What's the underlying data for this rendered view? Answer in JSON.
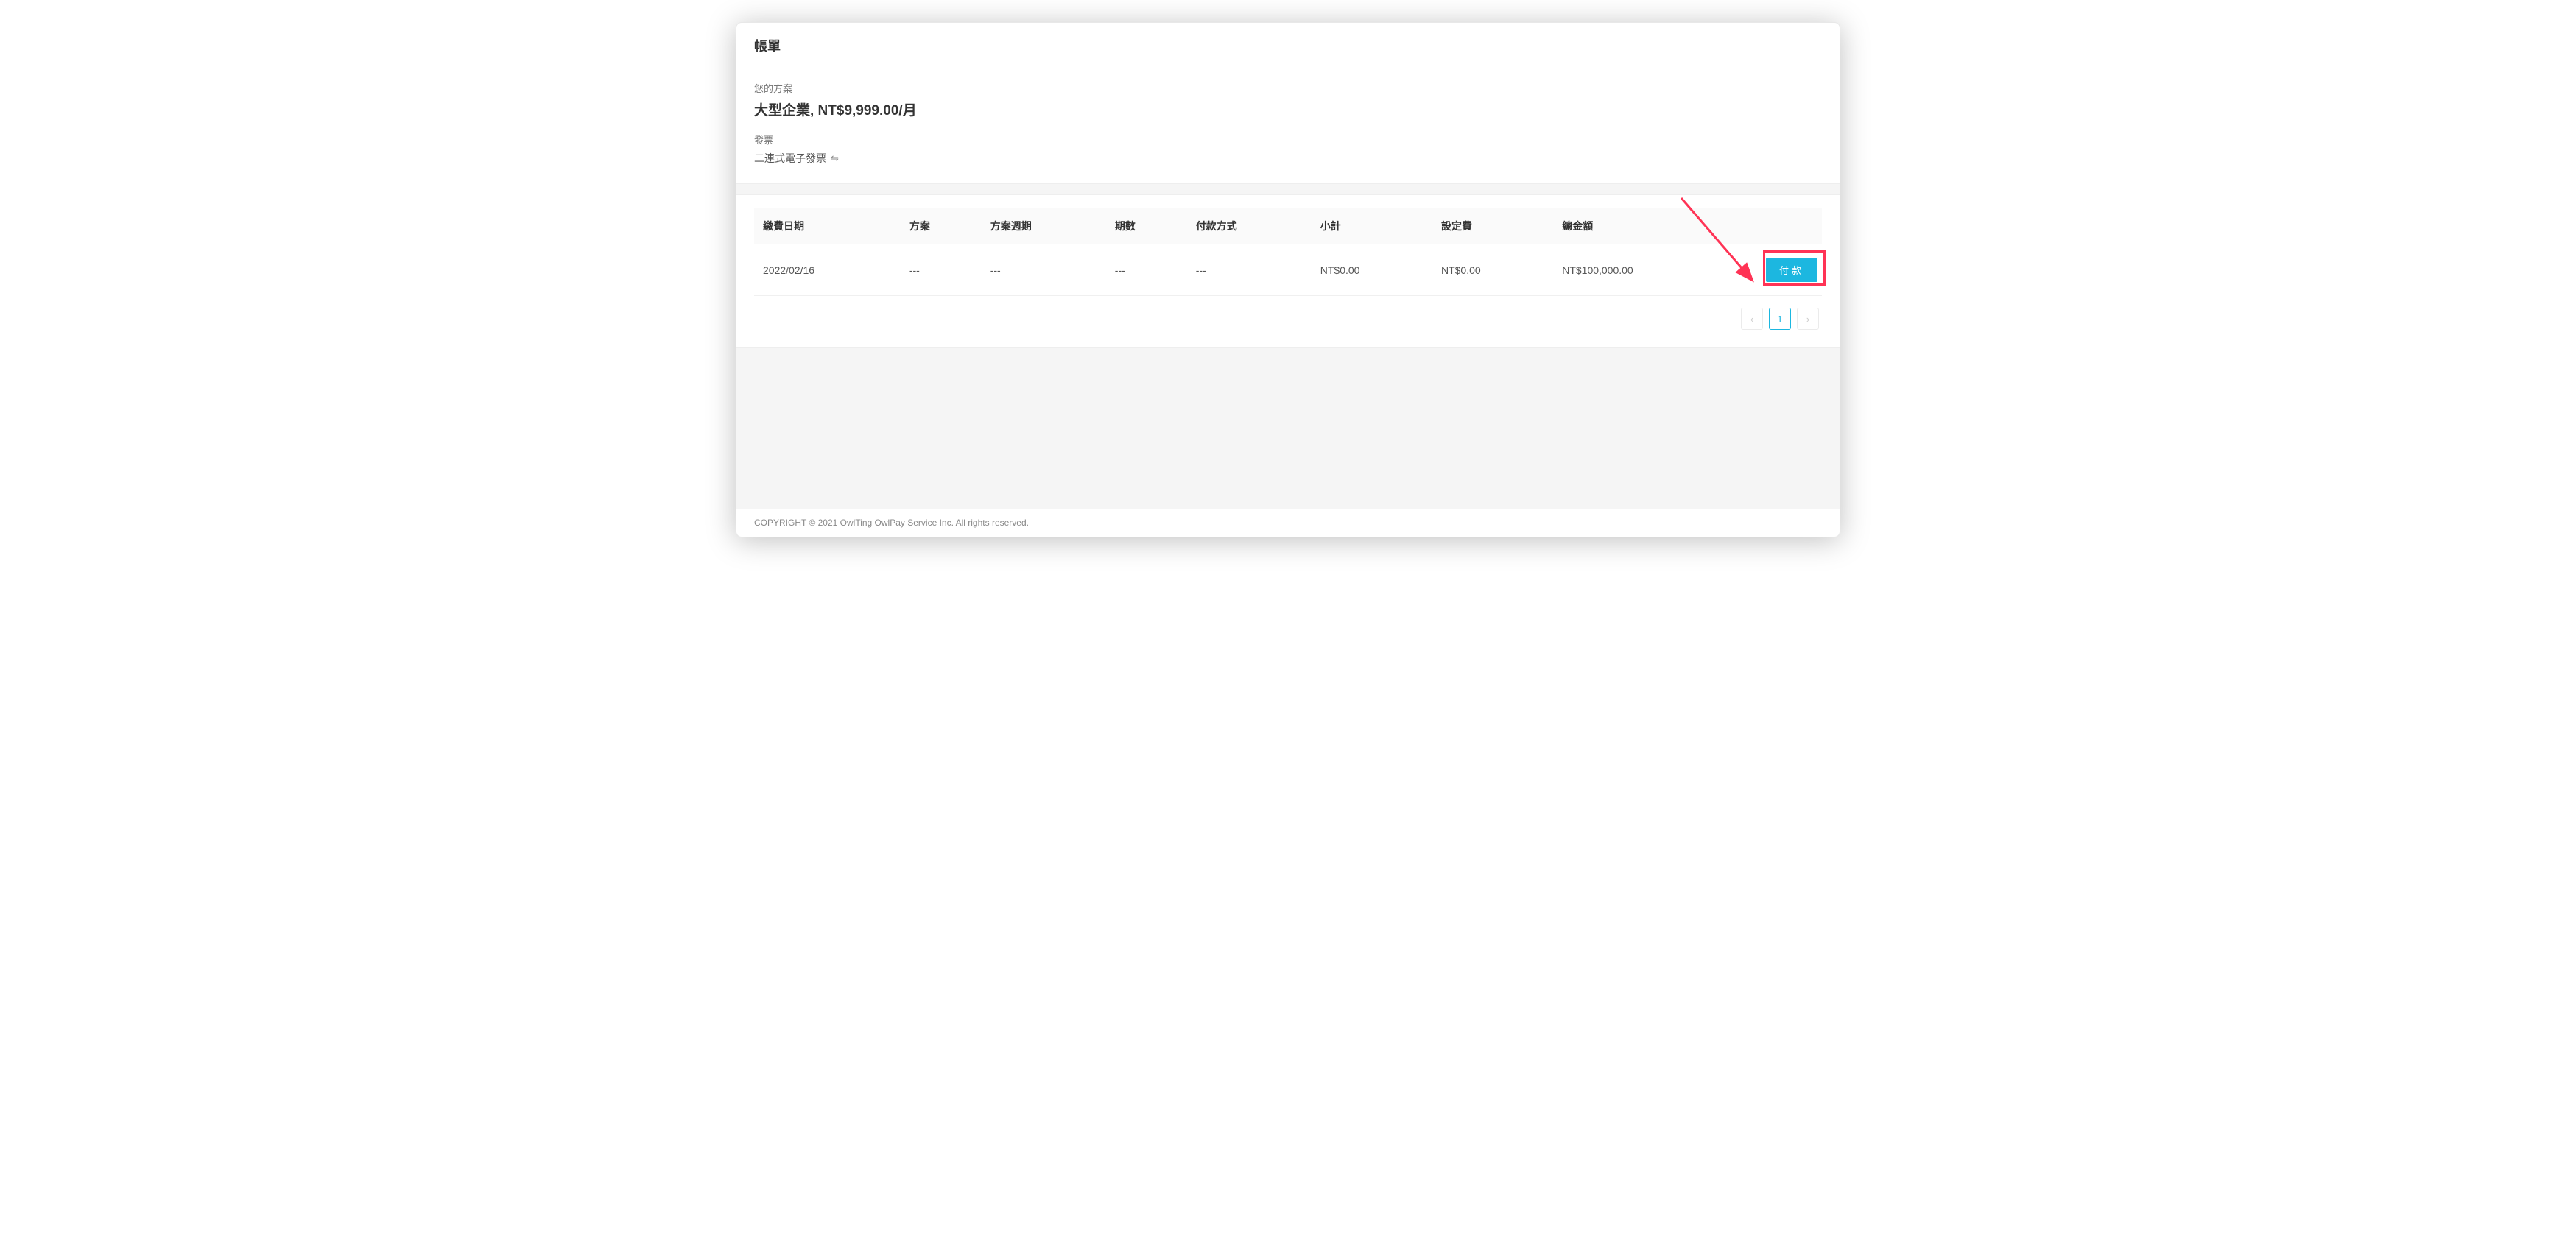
{
  "page": {
    "title": "帳單"
  },
  "plan": {
    "label": "您的方案",
    "value": "大型企業, NT$9,999.00/月"
  },
  "invoice": {
    "label": "發票",
    "value": "二連式電子發票"
  },
  "table": {
    "headers": {
      "date": "繳費日期",
      "plan": "方案",
      "period": "方案週期",
      "term": "期數",
      "payment_method": "付款方式",
      "subtotal": "小計",
      "setup_fee": "設定費",
      "total": "總金額",
      "action": ""
    },
    "row": {
      "date": "2022/02/16",
      "plan": "---",
      "period": "---",
      "term": "---",
      "payment_method": "---",
      "subtotal": "NT$0.00",
      "setup_fee": "NT$0.00",
      "total": "NT$100,000.00",
      "pay_label": "付款"
    }
  },
  "pagination": {
    "current": "1"
  },
  "footer": {
    "copyright": "COPYRIGHT © 2021 OwlTing OwlPay Service Inc. All rights reserved."
  }
}
